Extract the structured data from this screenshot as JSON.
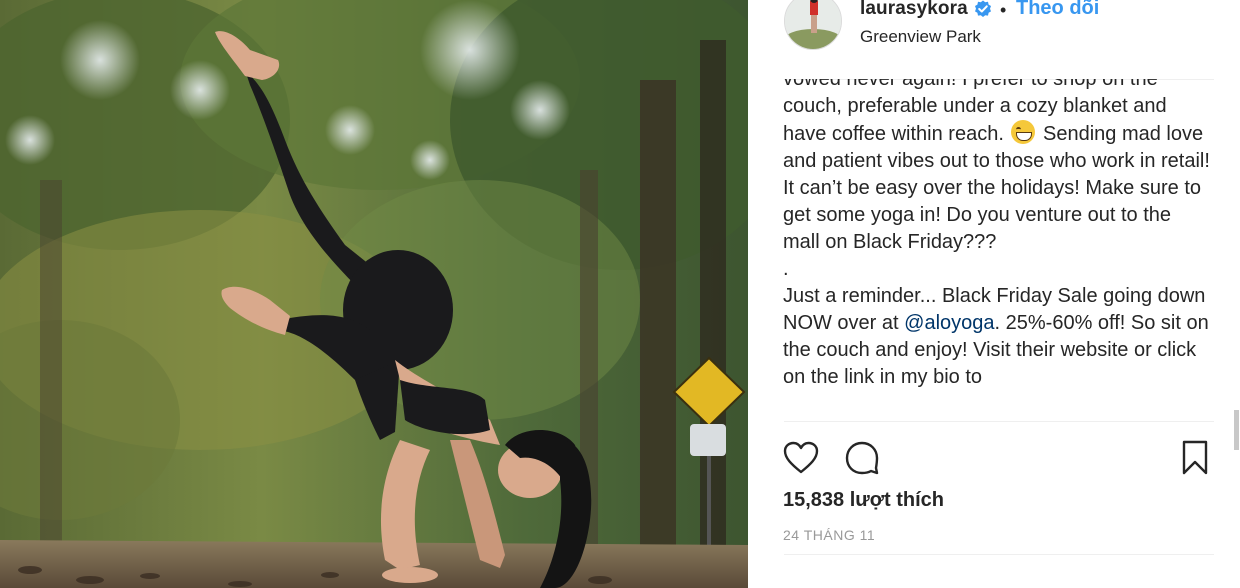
{
  "post": {
    "username": "laurasykora",
    "separator_dot": "•",
    "follow_label": "Theo dõi",
    "location": "Greenview Park",
    "verified_icon": "verified-badge-icon",
    "caption_lines": [
      "vowed never again! I prefer to shop on the couch, preferable under a cozy blanket and have coffee within reach.",
      "Sending mad love and patient vibes out to those who work in retail! It can’t be easy over the holidays! Make sure to get some yoga in! Do you venture out to the mall on Black Friday???",
      ".",
      "Just a reminder... Black Friday Sale going down NOW over at",
      "@aloyoga",
      ". 25%-60% off! So sit on the couch and enjoy! Visit their website or click on the link in my bio to"
    ],
    "likes": "15,838 lượt thích",
    "date": "24 THÁNG 11"
  },
  "icons": {
    "like": "heart-icon",
    "comment": "comment-icon",
    "save": "bookmark-icon"
  },
  "colors": {
    "accent": "#3897f0",
    "text": "#262626",
    "mention": "#003569",
    "muted": "#999999",
    "divider": "#efefef"
  }
}
